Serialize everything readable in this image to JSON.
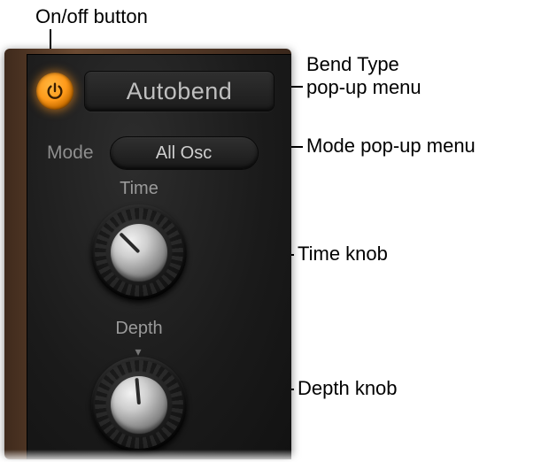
{
  "annotations": {
    "onoff": "On/off button",
    "bend": "Bend Type\npop-up menu",
    "mode": "Mode pop-up menu",
    "time": "Time knob",
    "depth": "Depth knob"
  },
  "header": {
    "bend_type_label": "Autobend"
  },
  "mode": {
    "label": "Mode",
    "selected": "All Osc"
  },
  "knobs": {
    "time": {
      "label": "Time"
    },
    "depth": {
      "label": "Depth",
      "ticks": "▾"
    }
  },
  "colors": {
    "accent": "#ff9a1a"
  }
}
